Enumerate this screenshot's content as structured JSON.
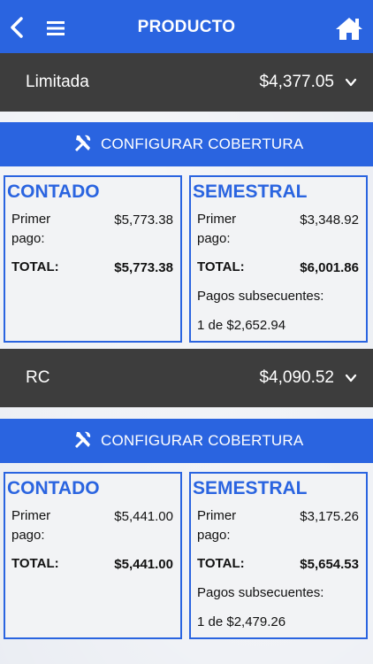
{
  "header": {
    "title": "PRODUCTO"
  },
  "plans": [
    {
      "name": "Limitada",
      "price": "$4,377.05",
      "config_label": "CONFIGURAR COBERTURA",
      "contado": {
        "title": "CONTADO",
        "first_label": "Primer pago:",
        "first_value": "$5,773.38",
        "total_label": "TOTAL:",
        "total_value": "$5,773.38"
      },
      "semestral": {
        "title": "SEMESTRAL",
        "first_label": "Primer pago:",
        "first_value": "$3,348.92",
        "total_label": "TOTAL:",
        "total_value": "$6,001.86",
        "subseq_label": "Pagos subsecuentes:",
        "subseq_value": "1 de $2,652.94"
      }
    },
    {
      "name": "RC",
      "price": "$4,090.52",
      "config_label": "CONFIGURAR COBERTURA",
      "contado": {
        "title": "CONTADO",
        "first_label": "Primer pago:",
        "first_value": "$5,441.00",
        "total_label": "TOTAL:",
        "total_value": "$5,441.00"
      },
      "semestral": {
        "title": "SEMESTRAL",
        "first_label": "Primer pago:",
        "first_value": "$3,175.26",
        "total_label": "TOTAL:",
        "total_value": "$5,654.53",
        "subseq_label": "Pagos subsecuentes:",
        "subseq_value": "1 de $2,479.26"
      }
    }
  ],
  "colors": {
    "accent": "#2a64e0",
    "plan_row": "#3d3d3d",
    "card_bg": "#f2f3f5"
  }
}
